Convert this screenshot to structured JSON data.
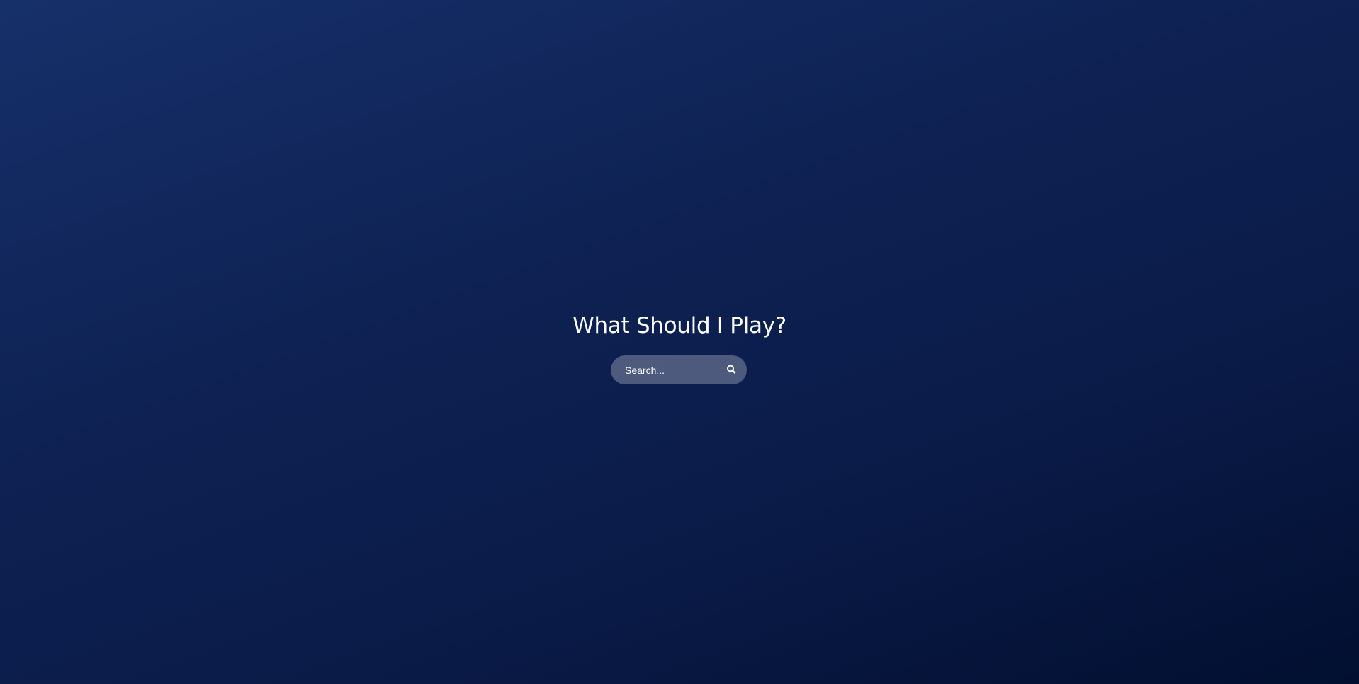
{
  "page": {
    "title": "What Should I Play?"
  },
  "search": {
    "placeholder": "Search...",
    "value": "",
    "icon": "search-icon"
  },
  "colors": {
    "background_top": "#16306a",
    "background_bottom": "#020f30",
    "text": "#ffffff"
  }
}
